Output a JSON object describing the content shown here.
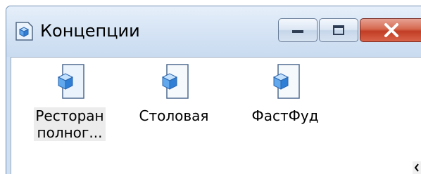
{
  "window": {
    "title": "Концепции",
    "icons": {
      "title": "cube-doc-icon",
      "minimize": "minimize-icon",
      "maximize": "maximize-icon",
      "close": "close-icon"
    },
    "colors": {
      "titlebar": "#d7e5f5",
      "close": "#c9452d",
      "client": "#ffffff"
    }
  },
  "items": [
    {
      "label": "Ресторан полног...",
      "line1": "Ресторан",
      "line2": "полног...",
      "icon": "cube-document-icon",
      "selected": true
    },
    {
      "label": "Столовая",
      "icon": "cube-document-icon",
      "selected": false
    },
    {
      "label": "ФастФуд",
      "icon": "cube-document-icon",
      "selected": false
    }
  ],
  "scrollbar": {
    "arrow": "scroll-left-arrow-icon"
  }
}
